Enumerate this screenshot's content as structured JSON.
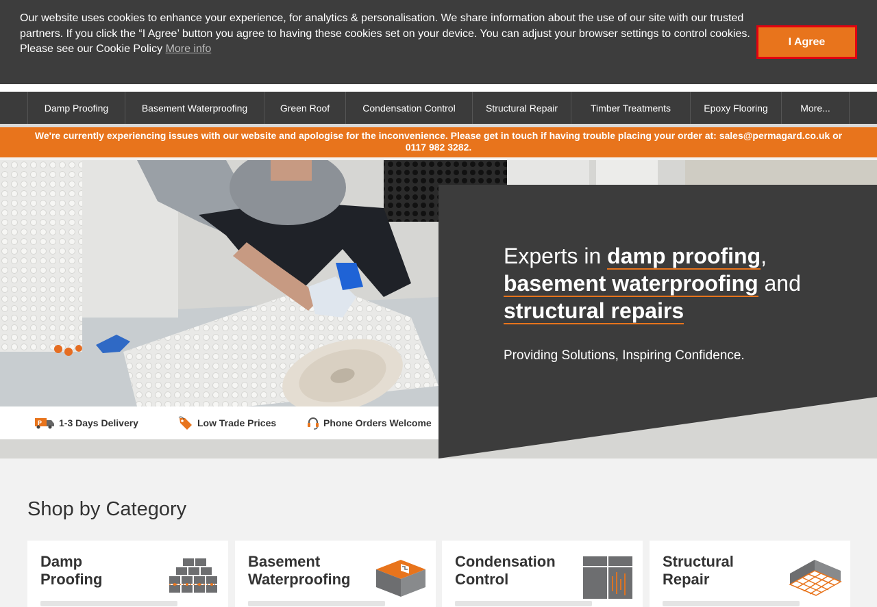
{
  "cookie_banner": {
    "text": "Our website uses cookies to enhance your experience, for analytics & personalisation. We share information about the use of our site with our trusted partners. If you click the “I Agree’ button you agree to having these cookies set on your device. You can adjust your browser settings to control cookies.",
    "policy_text": "Please see our Cookie Policy ",
    "more_info_label": "More info",
    "agree_label": "I Agree"
  },
  "nav": {
    "items": [
      {
        "label": "Damp Proofing"
      },
      {
        "label": "Basement Waterproofing"
      },
      {
        "label": "Green Roof"
      },
      {
        "label": "Condensation Control"
      },
      {
        "label": "Structural Repair"
      },
      {
        "label": "Timber Treatments"
      },
      {
        "label": "Epoxy Flooring"
      },
      {
        "label": "More..."
      }
    ]
  },
  "alert": {
    "text": "We're currently experiencing issues with our website and apologise for the inconvenience. Please get in touch if having trouble placing your order at: sales@permagard.co.uk or 0117 982 3282."
  },
  "hero": {
    "heading_prefix": "Experts in ",
    "highlight_1": "damp proofing",
    "sep_1": ",",
    "highlight_2": "basement waterproofing",
    "sep_2": " and",
    "highlight_3": "structural repairs",
    "subtitle": "Providing Solutions, Inspiring Confidence."
  },
  "usp": {
    "delivery": "1-3 Days Delivery",
    "prices": "Low Trade Prices",
    "phone": "Phone Orders Welcome"
  },
  "shop": {
    "title": "Shop by Category",
    "cards": [
      {
        "line1": "Damp",
        "line2": "Proofing",
        "icon": "bricks-icon"
      },
      {
        "line1": "Basement",
        "line2": "Waterproofing",
        "icon": "basement-icon"
      },
      {
        "line1": "Condensation",
        "line2": "Control",
        "icon": "window-icon"
      },
      {
        "line1": "Structural",
        "line2": "Repair",
        "icon": "floor-grid-icon"
      }
    ]
  },
  "colors": {
    "accent": "#e8741c",
    "dark": "#3b3b3b",
    "highlight_border": "#e3000f"
  }
}
